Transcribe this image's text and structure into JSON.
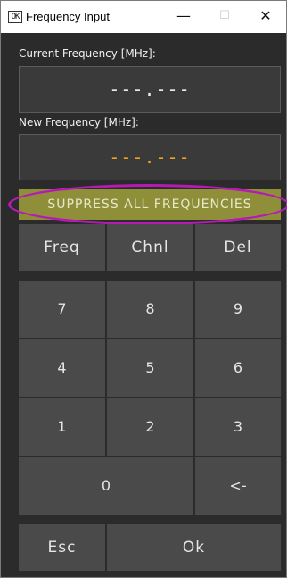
{
  "window": {
    "title": "Frequency Input",
    "icon_text": "OK",
    "minimize_glyph": "—",
    "maximize_glyph": "☐",
    "close_glyph": "✕"
  },
  "current": {
    "label": "Current Frequency [MHz]:",
    "value": "---.---"
  },
  "new": {
    "label": "New Frequency [MHz]:",
    "value": "---.---"
  },
  "suppress_label": "SUPPRESS ALL FREQUENCIES",
  "keys": {
    "freq": "Freq",
    "chnl": "Chnl",
    "del": "Del",
    "k7": "7",
    "k8": "8",
    "k9": "9",
    "k4": "4",
    "k5": "5",
    "k6": "6",
    "k1": "1",
    "k2": "2",
    "k3": "3",
    "k0": "0",
    "backspace": "<-",
    "esc": "Esc",
    "ok": "Ok"
  },
  "colors": {
    "background": "#2b2b2b",
    "key": "#4a4a4a",
    "new_value": "#f0a020",
    "suppress": "#8f8f3a",
    "highlight_ring": "#b51ab5"
  }
}
